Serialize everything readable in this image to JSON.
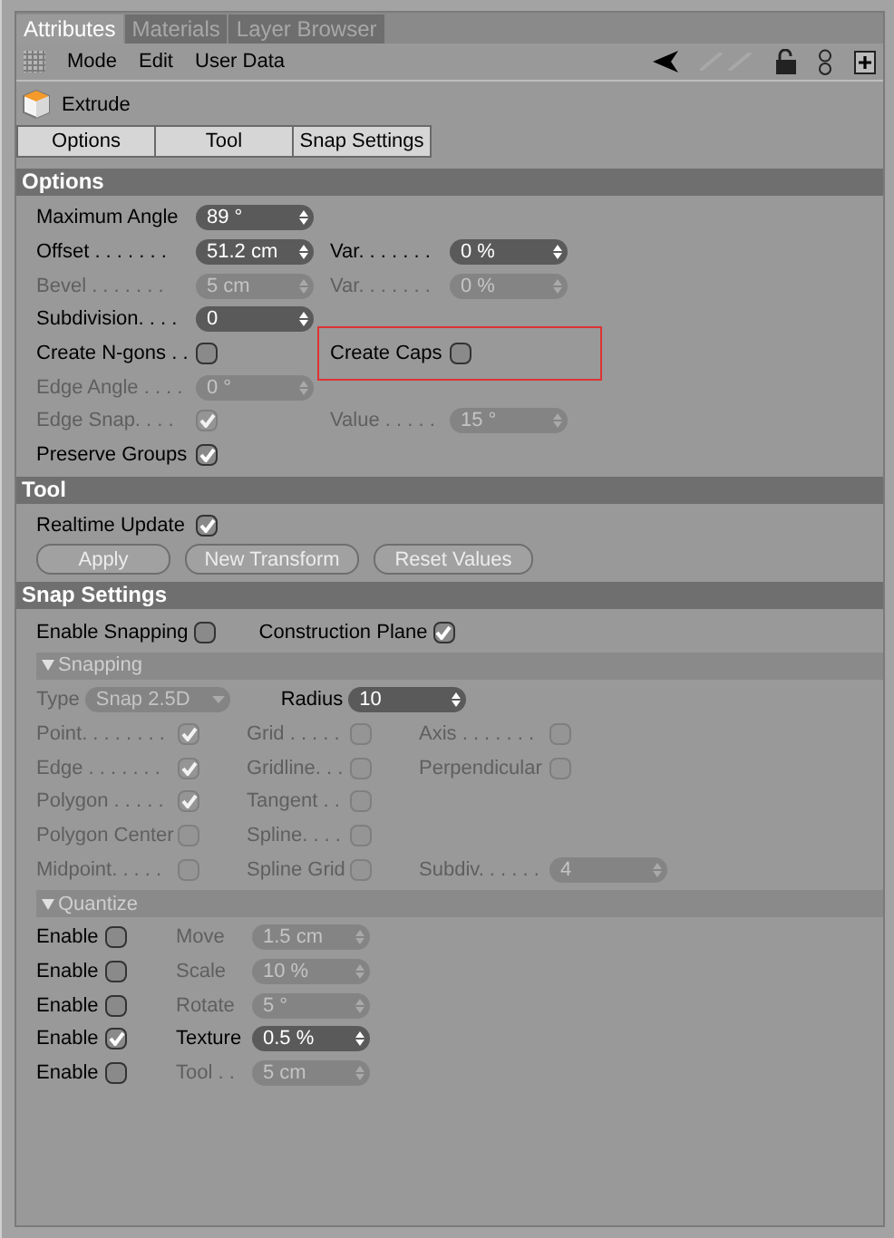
{
  "tabs": [
    {
      "label": "Attributes",
      "selected": true
    },
    {
      "label": "Materials",
      "selected": false
    },
    {
      "label": "Layer Browser",
      "selected": false
    }
  ],
  "menu": [
    "Mode",
    "Edit",
    "User Data"
  ],
  "object": {
    "name": "Extrude"
  },
  "subtabs": [
    "Options",
    "Tool",
    "Snap Settings"
  ],
  "sections": [
    {
      "kind": "options",
      "title": "Options",
      "rows": [
        [
          {
            "label": "Maximum Angle",
            "kind": "spin",
            "value": "89 °",
            "disabled": false
          }
        ],
        [
          {
            "label": "Offset . . . . . . .",
            "kind": "spin",
            "value": "51.2 cm",
            "disabled": false
          },
          {
            "label": "Var. . . . . . .",
            "kind": "spin",
            "value": "0 %",
            "disabled": false
          }
        ],
        [
          {
            "label": "Bevel . . . . . . .",
            "kind": "spin",
            "value": "5 cm",
            "disabled": true
          },
          {
            "label": "Var. . . . . . .",
            "kind": "spin",
            "value": "0 %",
            "disabled": true
          }
        ],
        [
          {
            "label": "Subdivision. . . .",
            "kind": "spin",
            "value": "0",
            "disabled": false
          }
        ],
        [
          {
            "label": "Create N-gons . .",
            "kind": "check",
            "checked": false,
            "disabled": false
          },
          {
            "label": "Create Caps",
            "kind": "check",
            "checked": false,
            "disabled": false,
            "highlighted": true
          }
        ],
        [
          {
            "label": "Edge Angle . . . .",
            "kind": "spin",
            "value": "0 °",
            "disabled": true
          }
        ],
        [
          {
            "label": "Edge Snap. . . .",
            "kind": "check",
            "checked": true,
            "disabled": true
          },
          {
            "label": "Value . . . . .",
            "kind": "spin",
            "value": "15 °",
            "disabled": true
          }
        ],
        [
          {
            "label": "Preserve Groups",
            "kind": "check",
            "checked": true,
            "disabled": false
          }
        ]
      ]
    },
    {
      "kind": "tool",
      "title": "Tool",
      "rows": [
        [
          {
            "label": "Realtime Update",
            "kind": "check",
            "checked": true,
            "disabled": false
          }
        ]
      ],
      "buttons": [
        {
          "label": "Apply",
          "disabled": true
        },
        {
          "label": "New Transform",
          "disabled": true
        },
        {
          "label": "Reset Values",
          "disabled": true
        }
      ]
    },
    {
      "kind": "snap",
      "title": "Snap Settings",
      "rows": [
        [
          {
            "label": "Enable Snapping",
            "kind": "check",
            "checked": false,
            "disabled": false
          },
          {
            "label": "Construction Plane",
            "kind": "check",
            "checked": true,
            "disabled": false
          }
        ]
      ],
      "groups": [
        {
          "title": "Snapping",
          "kind": "snapping",
          "expanded": true,
          "type_row": [
            {
              "label": "Type",
              "kind": "dropdown",
              "value": "Snap 2.5D",
              "disabled": true
            },
            {
              "label": "Radius",
              "kind": "spin",
              "value": "10",
              "disabled": false
            }
          ],
          "rows": [
            [
              {
                "label": "Point. . . . . . . .",
                "kind": "check",
                "checked": true,
                "disabled": true
              },
              {
                "label": "Grid . . . . .",
                "kind": "check",
                "checked": false,
                "disabled": true
              },
              {
                "label": "Axis . . . . . . .",
                "kind": "check",
                "checked": false,
                "disabled": true
              }
            ],
            [
              {
                "label": "Edge . . . . . . .",
                "kind": "check",
                "checked": true,
                "disabled": true
              },
              {
                "label": "Gridline. . .",
                "kind": "check",
                "checked": false,
                "disabled": true
              },
              {
                "label": "Perpendicular",
                "kind": "check",
                "checked": false,
                "disabled": true
              }
            ],
            [
              {
                "label": "Polygon . . . . .",
                "kind": "check",
                "checked": true,
                "disabled": true
              },
              {
                "label": "Tangent . .",
                "kind": "check",
                "checked": false,
                "disabled": true
              }
            ],
            [
              {
                "label": "Polygon Center",
                "kind": "check",
                "checked": false,
                "disabled": true
              },
              {
                "label": "Spline. . . .",
                "kind": "check",
                "checked": false,
                "disabled": true
              }
            ],
            [
              {
                "label": "Midpoint. . . . .",
                "kind": "check",
                "checked": false,
                "disabled": true
              },
              {
                "label": "Spline Grid",
                "kind": "check",
                "checked": false,
                "disabled": true
              },
              {
                "label": "Subdiv. . . . . .",
                "kind": "spin",
                "value": "4",
                "disabled": true
              }
            ]
          ]
        },
        {
          "title": "Quantize",
          "kind": "quantize",
          "expanded": true,
          "rows": [
            [
              {
                "label": "Enable",
                "kind": "check",
                "checked": false,
                "disabled": false
              },
              {
                "label": "Move",
                "kind": "spin",
                "value": "1.5 cm",
                "disabled": true
              }
            ],
            [
              {
                "label": "Enable",
                "kind": "check",
                "checked": false,
                "disabled": false
              },
              {
                "label": "Scale",
                "kind": "spin",
                "value": "10 %",
                "disabled": true
              }
            ],
            [
              {
                "label": "Enable",
                "kind": "check",
                "checked": false,
                "disabled": false
              },
              {
                "label": "Rotate",
                "kind": "spin",
                "value": "5 °",
                "disabled": true
              }
            ],
            [
              {
                "label": "Enable",
                "kind": "check",
                "checked": true,
                "disabled": false
              },
              {
                "label": "Texture",
                "kind": "spin",
                "value": "0.5 %",
                "disabled": false
              }
            ],
            [
              {
                "label": "Enable",
                "kind": "check",
                "checked": false,
                "disabled": false
              },
              {
                "label": "Tool . .",
                "kind": "spin",
                "value": "5 cm",
                "disabled": true
              }
            ]
          ]
        }
      ]
    }
  ]
}
